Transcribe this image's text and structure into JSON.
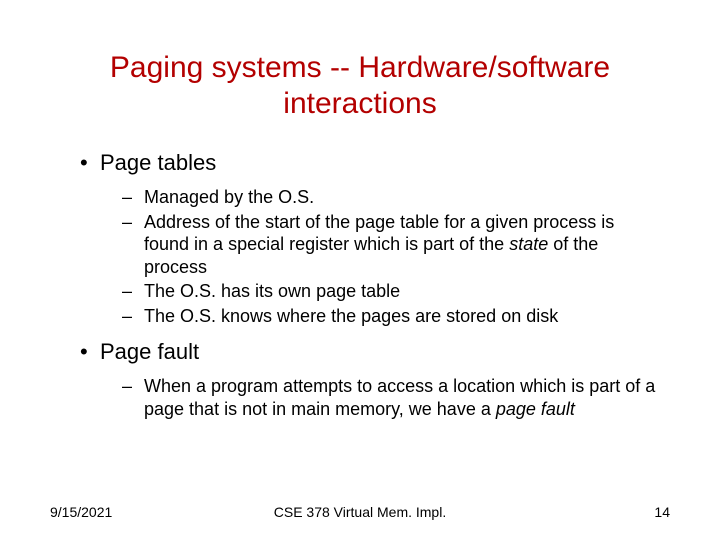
{
  "title": "Paging systems -- Hardware/software interactions",
  "bullets": [
    {
      "text": "Page tables",
      "sub": [
        {
          "text": "Managed by the O.S."
        },
        {
          "pre": "Address of the start of the page table for a given process is found in a special register which is part of the ",
          "em": "state",
          "post": " of the process"
        },
        {
          "text": "The O.S. has its own page table"
        },
        {
          "text": "The O.S. knows where the pages are stored on disk"
        }
      ]
    },
    {
      "text": "Page fault",
      "sub": [
        {
          "pre": "When a program attempts to access a location which is part of a page that is not in main memory, we have a ",
          "em": "page fault",
          "post": ""
        }
      ]
    }
  ],
  "footer": {
    "date": "9/15/2021",
    "course": "CSE 378 Virtual Mem. Impl.",
    "page": "14"
  }
}
